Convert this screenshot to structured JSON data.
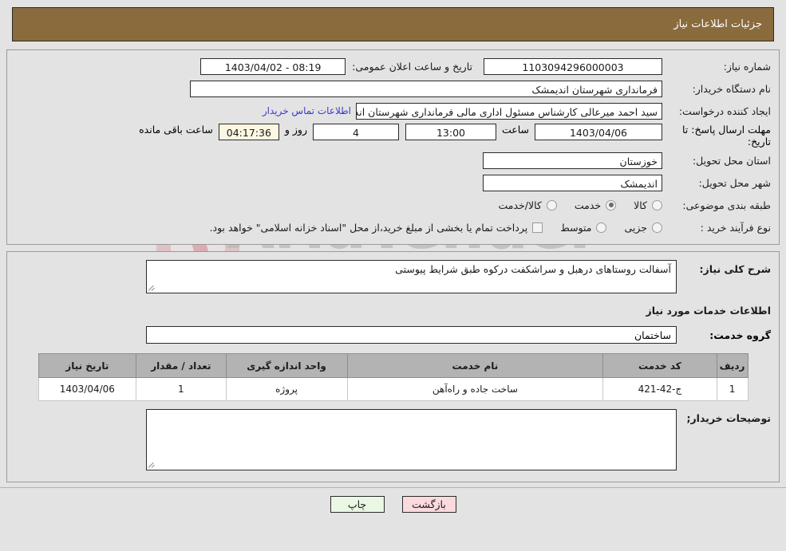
{
  "header": {
    "title": "جزئیات اطلاعات نیاز"
  },
  "form": {
    "need_number_label": "شماره نیاز:",
    "need_number_value": "1103094296000003",
    "announce_label": "تاریخ و ساعت اعلان عمومی:",
    "announce_value": "08:19 - 1403/04/02",
    "buyer_org_label": "نام دستگاه خریدار:",
    "buyer_org_value": "فرمانداری شهرستان اندیمشک",
    "creator_label": "ایجاد کننده درخواست:",
    "creator_value": "سید احمد میرعالی کارشناس مسئول اداری مالی فرمانداری شهرستان اندیمشک",
    "contact_link": "اطلاعات تماس خریدار",
    "deadline_label": "مهلت ارسال پاسخ: تا تاریخ:",
    "deadline_date": "1403/04/06",
    "hour_label": "ساعت",
    "hour_value": "13:00",
    "days_value": "4",
    "days_label": "روز و",
    "countdown_value": "04:17:36",
    "countdown_label": "ساعت باقی مانده",
    "province_label": "استان محل تحویل:",
    "province_value": "خوزستان",
    "city_label": "شهر محل تحویل:",
    "city_value": "اندیمشک",
    "category_label": "طبقه بندی موضوعی:",
    "category_options": [
      {
        "label": "کالا",
        "selected": false
      },
      {
        "label": "خدمت",
        "selected": true
      },
      {
        "label": "کالا/خدمت",
        "selected": false
      }
    ],
    "process_label": "نوع فرآیند خرید :",
    "process_options": [
      {
        "label": "جزیی",
        "selected": false
      },
      {
        "label": "متوسط",
        "selected": false
      }
    ],
    "treasury_note": "پرداخت تمام یا بخشی از مبلغ خرید،از محل \"اسناد خزانه اسلامی\" خواهد بود."
  },
  "details": {
    "summary_label": "شرح کلی نیاز:",
    "summary_value": "آسفالت روستاهای درهبل و سراشکفت درکوه طبق شرایط پیوستی",
    "services_heading": "اطلاعات خدمات مورد نیاز",
    "service_group_label": "گروه خدمت:",
    "service_group_value": "ساختمان",
    "buyer_notes_label": "توضیحات خریدار;",
    "buyer_notes_value": ""
  },
  "table": {
    "columns": [
      "ردیف",
      "کد خدمت",
      "نام خدمت",
      "واحد اندازه گیری",
      "تعداد / مقدار",
      "تاریخ نیاز"
    ],
    "rows": [
      {
        "radif": "1",
        "code": "ج-42-421",
        "name": "ساخت جاده و راه‌آهن",
        "unit": "پروژه",
        "qty": "1",
        "date": "1403/04/06"
      }
    ]
  },
  "footer": {
    "print_label": "چاپ",
    "back_label": "بازگشت"
  },
  "watermark": {
    "brand": "AriaTender",
    "suffix": ".net"
  },
  "colors": {
    "header_brown": "#8a6b3d",
    "page_bg": "#e3e3e3",
    "link_blue": "#3a3ad0",
    "back_btn": "#fbdadd",
    "print_btn": "#e9f7e4",
    "countdown_bg": "#fbf7e2",
    "table_header": "#b3b3b3"
  }
}
